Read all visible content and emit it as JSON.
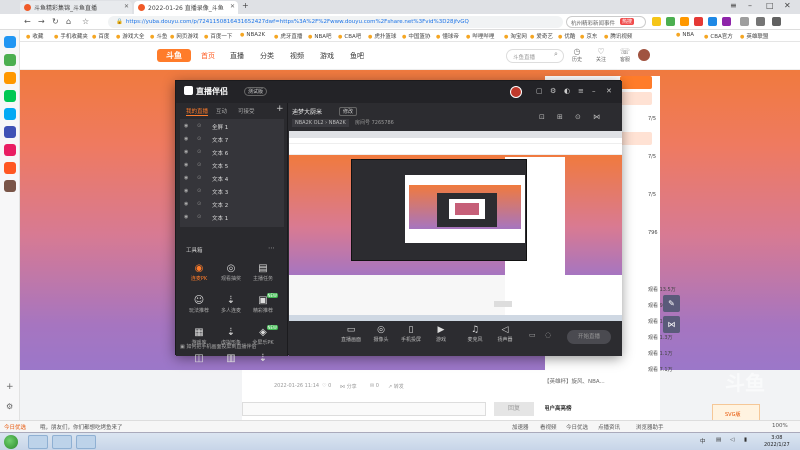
{
  "browser": {
    "tabs": [
      {
        "title": "斗鱼精彩集锦_斗鱼直播"
      },
      {
        "title": "2022-01-26 直播录像_斗鱼"
      }
    ],
    "url": "https://yuba.douyu.com/p/7241150816431652427dwf=https%3A%2F%2Fwww.douyu.com%2Fshare.net%3Fvid%3D28jfvGQ",
    "search_engine_text": "杭州精彩新闻事件",
    "hot_badge": "热搜",
    "bookmarks": [
      "收藏",
      "手机收藏夹",
      "百度",
      "游戏大全",
      "斗鱼",
      "网页游戏",
      "百度一下",
      "NBA2K",
      "虎牙直播",
      "NBA吧",
      "CBA吧",
      "虎扑篮球",
      "中国篮协",
      "懂球帝",
      "哔哩哔哩",
      "淘宝网",
      "爱奇艺",
      "优酷",
      "京东",
      "腾讯视频",
      "NBA",
      "CBA官方",
      "英雄联盟"
    ]
  },
  "site": {
    "logo": "斗鱼",
    "nav": [
      "首页",
      "直播",
      "分类",
      "视频",
      "游戏",
      "鱼吧"
    ],
    "search_placeholder": "斗鱼直播",
    "header_icons": [
      "历史",
      "关注",
      "客服"
    ]
  },
  "right_panel": {
    "items": [
      {
        "label": "7/5",
        "num": "1.3万"
      },
      {
        "label": "7/5",
        "num": "1.3万"
      },
      {
        "label": "7/5",
        "num": "1.3万"
      }
    ],
    "stat": "796",
    "views": [
      "观看 13.5万",
      "观看 9.2万",
      "观看 1.2万",
      "观看 1.3万",
      "观看 1.1万",
      "观看 7.1万"
    ],
    "promo": "【英雄杯】旋风、NBA...",
    "user_section": "用户高亮榜"
  },
  "post": {
    "meta": "2022-01-26 11:14",
    "actions": [
      "0",
      "分享",
      "0",
      "转发"
    ],
    "reply_button": "回复",
    "ad": "SVG版"
  },
  "app": {
    "title": "直播伴侣",
    "version": "测试版",
    "side_tabs": [
      "我的直播",
      "互动",
      "可接受"
    ],
    "scenes": [
      {
        "name": "全屏 1",
        "selected": true
      },
      {
        "name": "文本 7"
      },
      {
        "name": "文本 6"
      },
      {
        "name": "文本 5"
      },
      {
        "name": "文本 4"
      },
      {
        "name": "文本 3"
      },
      {
        "name": "文本 2"
      },
      {
        "name": "文本 1"
      }
    ],
    "tools_title": "工具箱",
    "tools": [
      {
        "label": "连麦PK",
        "icon": "◉",
        "on": true
      },
      {
        "label": "观看抽奖",
        "icon": "◎"
      },
      {
        "label": "主播任务",
        "icon": "▤"
      },
      {
        "label": "玩法推荐",
        "icon": "☺"
      },
      {
        "label": "多人连麦",
        "icon": "⇣"
      },
      {
        "label": "精彩推荐",
        "icon": "▣",
        "new": "NEW"
      },
      {
        "label": "游戏库",
        "icon": "▦"
      },
      {
        "label": "虚拟形象",
        "icon": "⇣"
      },
      {
        "label": "全屏乐PK",
        "icon": "◈",
        "new": "NEW"
      },
      {
        "label": "直播间",
        "icon": "◫"
      },
      {
        "label": "文字",
        "icon": "▥"
      },
      {
        "label": "下载",
        "icon": "⇣"
      }
    ],
    "bottom_hint": "如何把手机画面投屏到直播伴侣",
    "room_title": "迪梦大厨米",
    "room_edit": "修改",
    "room_tags": "NBA2K OL2 › NBA2K",
    "room_info": "房间号 7265786",
    "controls": [
      "直播画面",
      "摄像头",
      "手机投屏",
      "游戏",
      "麦克风",
      "扬声器"
    ],
    "start_button": "开始直播"
  },
  "statusbar": {
    "left": "今日优选",
    "items": [
      "哦，朋友们，你们都想吃烤鱼来了"
    ],
    "right": [
      "加速器",
      "看视频",
      "今日优选",
      "点播资讯",
      "浏览器助手"
    ],
    "zoom": "100%"
  },
  "taskbar": {
    "time": "3:08",
    "date": "2022/1/27",
    "lang": "中"
  },
  "colors": {
    "accent": "#ff7c2a",
    "app_bg": "#2c2c30",
    "banner_top": "#f07a3e",
    "banner_bottom": "#9b77c9"
  }
}
